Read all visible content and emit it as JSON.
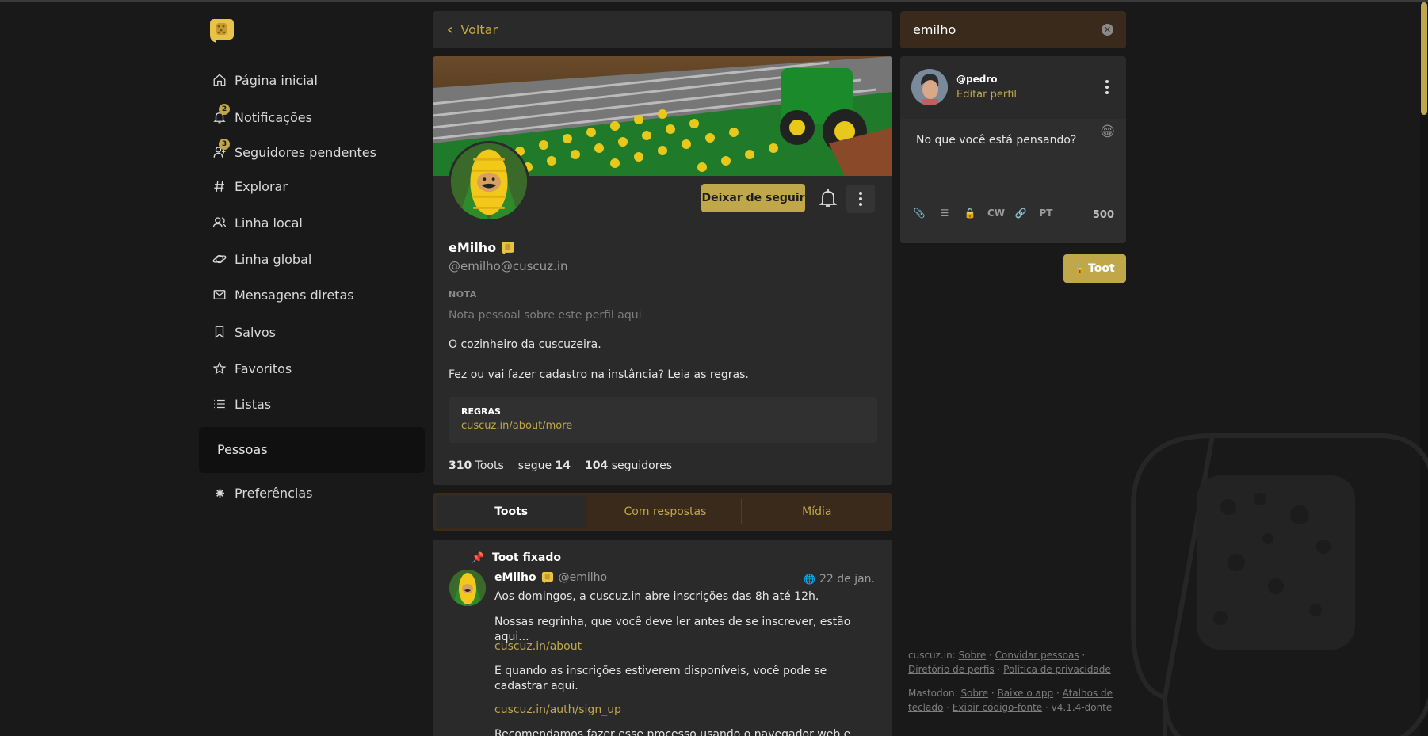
{
  "nav": {
    "items": [
      {
        "label": "Página inicial",
        "icon": "home-icon"
      },
      {
        "label": "Notificações",
        "icon": "bell-icon",
        "badge": "2"
      },
      {
        "label": "Seguidores pendentes",
        "icon": "user-add-icon",
        "badge": "3"
      },
      {
        "label": "Explorar",
        "icon": "hashtag-icon"
      },
      {
        "label": "Linha local",
        "icon": "users-icon"
      },
      {
        "label": "Linha global",
        "icon": "globe-icon"
      },
      {
        "label": "Mensagens diretas",
        "icon": "envelope-icon"
      },
      {
        "label": "Salvos",
        "icon": "bookmark-icon"
      },
      {
        "label": "Favoritos",
        "icon": "star-icon"
      },
      {
        "label": "Listas",
        "icon": "list-icon"
      }
    ],
    "active": "Pessoas",
    "preferences": "Preferências"
  },
  "header": {
    "back_label": "Voltar"
  },
  "profile": {
    "display_name": "eMilho",
    "handle": "@emilho@cuscuz.in",
    "unfollow_label": "Deixar de seguir",
    "note_label": "NOTA",
    "note_placeholder": "Nota pessoal sobre este perfil aqui",
    "bio_line1": "O cozinheiro da cuscuzeira.",
    "bio_line2": "Fez ou vai fazer cadastro na instância? Leia as regras.",
    "field_name": "REGRAS",
    "field_value": "cuscuz.in/about/more",
    "toots_count": "310",
    "toots_label": "Toots",
    "following_label": "segue",
    "following_count": "14",
    "followers_count": "104",
    "followers_label": "seguidores"
  },
  "tabs": [
    "Toots",
    "Com respostas",
    "Mídia"
  ],
  "status": {
    "pinned_label": "Toot fixado",
    "author": "eMilho",
    "handle": "@emilho",
    "date": "22 de jan.",
    "line1": "Aos domingos, a cuscuz.in abre inscrições das 8h até 12h.",
    "line2": "Nossas regrinha, que você deve ler antes de se inscrever, estão aqui...",
    "link1": "cuscuz.in/about",
    "line3": "E quando as inscrições estiverem disponíveis, você pode se cadastrar aqui.",
    "link2": "cuscuz.in/auth/sign_up",
    "line4": "Recomendamos fazer esse processo usando o navegador web e não..."
  },
  "search": {
    "value": "emilho"
  },
  "compose": {
    "my_handle": "@pedro",
    "edit_profile": "Editar perfil",
    "placeholder": "No que você está pensando?",
    "cw_label": "CW",
    "lang_label": "PT",
    "char_count": "500",
    "toot_label": "Toot"
  },
  "footer": {
    "instance": "cuscuz.in",
    "about": "Sobre",
    "invite": "Convidar pessoas",
    "directory": "Diretório de perfis",
    "privacy": "Política de privacidade",
    "mastodon": "Mastodon",
    "about2": "Sobre",
    "app": "Baixe o app",
    "shortcuts": "Atalhos de teclado",
    "source": "Exibir código-fonte",
    "version": "v4.1.4-donte"
  },
  "colors": {
    "accent": "#c0a84a",
    "background": "#191919",
    "card": "#2a2a2a",
    "tab_bg": "#3a2a1c"
  }
}
